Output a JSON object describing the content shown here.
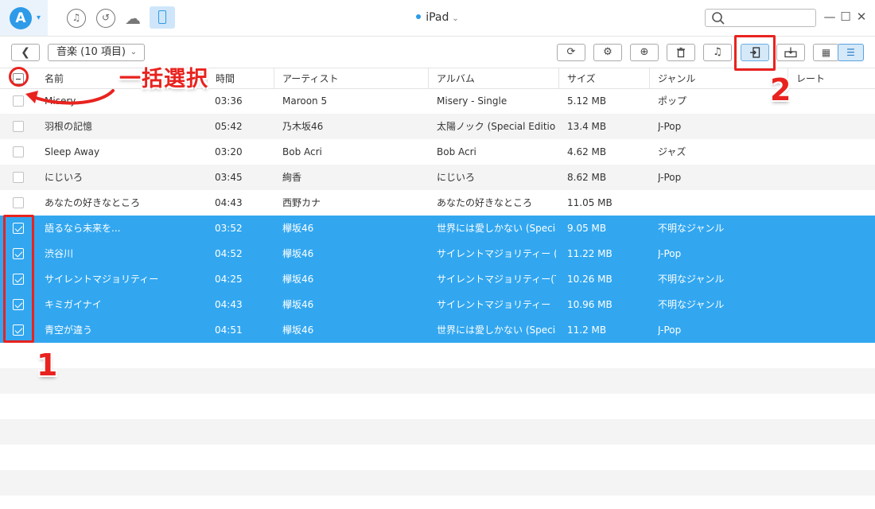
{
  "titlebar": {
    "logo_letter": "A",
    "device_name": "iPad",
    "search": {
      "placeholder": "",
      "value": ""
    },
    "icons": [
      "music-icon",
      "history-icon",
      "cloud-icon",
      "ipad-icon"
    ],
    "window_controls": [
      "minimize",
      "maximize",
      "close"
    ]
  },
  "toolbar": {
    "category_label": "音楽 (10 項目)",
    "tools": [
      "refresh-icon",
      "settings-icon",
      "add-icon",
      "delete-icon",
      "to-itunes-icon",
      "to-computer-icon",
      "to-device-icon"
    ],
    "views": [
      "grid-view-icon",
      "list-view-icon"
    ],
    "active_view": "list"
  },
  "table": {
    "headers": {
      "name": "名前",
      "time": "時間",
      "artist": "アーティスト",
      "album": "アルバム",
      "size": "サイズ",
      "genre": "ジャンル",
      "rate": "レート"
    },
    "rows": [
      {
        "name": "Misery",
        "time": "03:36",
        "artist": "Maroon 5",
        "album": "Misery - Single",
        "size": "5.12 MB",
        "genre": "ポップ",
        "selected": false
      },
      {
        "name": "羽根の記憶",
        "time": "05:42",
        "artist": "乃木坂46",
        "album": "太陽ノック (Special Edition)",
        "size": "13.4 MB",
        "genre": "J-Pop",
        "selected": false
      },
      {
        "name": "Sleep Away",
        "time": "03:20",
        "artist": "Bob Acri",
        "album": "Bob Acri",
        "size": "4.62 MB",
        "genre": "ジャズ",
        "selected": false
      },
      {
        "name": "にじいろ",
        "time": "03:45",
        "artist": "絢香",
        "album": "にじいろ",
        "size": "8.62 MB",
        "genre": "J-Pop",
        "selected": false
      },
      {
        "name": "あなたの好きなところ",
        "time": "04:43",
        "artist": "西野カナ",
        "album": "あなたの好きなところ",
        "size": "11.05 MB",
        "genre": "",
        "selected": false
      },
      {
        "name": "語るなら未来を...",
        "time": "03:52",
        "artist": "欅坂46",
        "album": "世界には愛しかない (Specia...",
        "size": "9.05 MB",
        "genre": "不明なジャンル",
        "selected": true
      },
      {
        "name": "渋谷川",
        "time": "04:52",
        "artist": "欅坂46",
        "album": "サイレントマジョリティー (Spec...",
        "size": "11.22 MB",
        "genre": "J-Pop",
        "selected": true
      },
      {
        "name": "サイレントマジョリティー",
        "time": "04:25",
        "artist": "欅坂46",
        "album": "サイレントマジョリティー(TYPE...",
        "size": "10.26 MB",
        "genre": "不明なジャンル",
        "selected": true
      },
      {
        "name": "キミガイナイ",
        "time": "04:43",
        "artist": "欅坂46",
        "album": "サイレントマジョリティー",
        "size": "10.96 MB",
        "genre": "不明なジャンル",
        "selected": true
      },
      {
        "name": "青空が違う",
        "time": "04:51",
        "artist": "欅坂46",
        "album": "世界には愛しかない (Specia...",
        "size": "11.2 MB",
        "genre": "J-Pop",
        "selected": true
      }
    ]
  },
  "annotations": {
    "select_all_label": "一括選択",
    "step1": "1",
    "step2": "2",
    "accent_color": "#e8231f"
  },
  "colors": {
    "brand": "#2d9be8",
    "selection": "#32a7f0",
    "alt_row": "#f4f4f4"
  }
}
